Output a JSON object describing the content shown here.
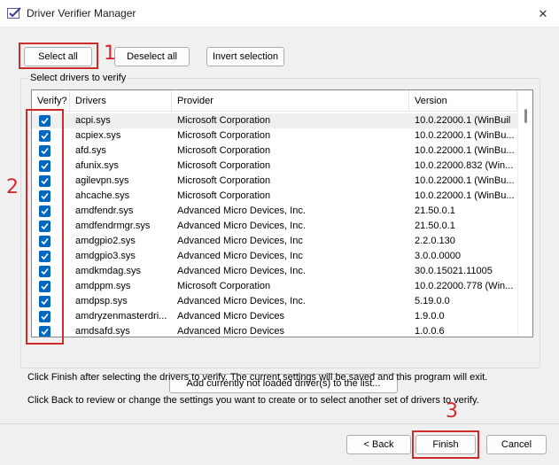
{
  "window": {
    "title": "Driver Verifier Manager",
    "close_glyph": "✕",
    "icon": "verifier-app-icon"
  },
  "toolbar": {
    "select_all": "Select all",
    "deselect_all": "Deselect all",
    "invert_selection": "Invert selection"
  },
  "group": {
    "label": "Select drivers to verify"
  },
  "list": {
    "columns": [
      "Verify?",
      "Drivers",
      "Provider",
      "Version"
    ],
    "rows": [
      {
        "driver": "acpi.sys",
        "provider": "Microsoft Corporation",
        "version": "10.0.22000.1 (WinBuil"
      },
      {
        "driver": "acpiex.sys",
        "provider": "Microsoft Corporation",
        "version": "10.0.22000.1 (WinBu..."
      },
      {
        "driver": "afd.sys",
        "provider": "Microsoft Corporation",
        "version": "10.0.22000.1 (WinBu..."
      },
      {
        "driver": "afunix.sys",
        "provider": "Microsoft Corporation",
        "version": "10.0.22000.832 (Win..."
      },
      {
        "driver": "agilevpn.sys",
        "provider": "Microsoft Corporation",
        "version": "10.0.22000.1 (WinBu..."
      },
      {
        "driver": "ahcache.sys",
        "provider": "Microsoft Corporation",
        "version": "10.0.22000.1 (WinBu..."
      },
      {
        "driver": "amdfendr.sys",
        "provider": "Advanced Micro Devices, Inc.",
        "version": "21.50.0.1"
      },
      {
        "driver": "amdfendrmgr.sys",
        "provider": "Advanced Micro Devices, Inc.",
        "version": "21.50.0.1"
      },
      {
        "driver": "amdgpio2.sys",
        "provider": "Advanced Micro Devices, Inc",
        "version": "2.2.0.130"
      },
      {
        "driver": "amdgpio3.sys",
        "provider": "Advanced Micro Devices, Inc",
        "version": "3.0.0.0000"
      },
      {
        "driver": "amdkmdag.sys",
        "provider": "Advanced Micro Devices, Inc.",
        "version": "30.0.15021.11005"
      },
      {
        "driver": "amdppm.sys",
        "provider": "Microsoft Corporation",
        "version": "10.0.22000.778 (Win..."
      },
      {
        "driver": "amdpsp.sys",
        "provider": "Advanced Micro Devices, Inc.",
        "version": "5.19.0.0"
      },
      {
        "driver": "amdryzenmasterdri...",
        "provider": "Advanced Micro Devices",
        "version": "1.9.0.0"
      },
      {
        "driver": "amdsafd.sys",
        "provider": "Advanced Micro Devices",
        "version": "1.0.0.6"
      }
    ]
  },
  "add_button": "Add currently not loaded driver(s) to the list...",
  "info": {
    "line1": "Click Finish after selecting the drivers to verify. The current settings will be saved and this program will exit.",
    "line2": "Click Back to review or change the settings you want to create or to select another set of drivers to verify."
  },
  "footer": {
    "back": "< Back",
    "finish": "Finish",
    "cancel": "Cancel"
  },
  "annotations": {
    "marker1": "1",
    "marker2": "2",
    "marker3": "3"
  },
  "colors": {
    "annotation": "#d12c2c",
    "checkbox": "#0067c0",
    "background": "#f0f0f0"
  }
}
